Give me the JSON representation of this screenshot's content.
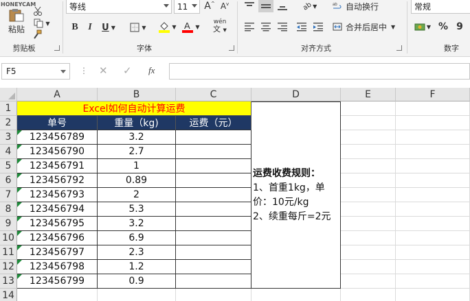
{
  "ribbon": {
    "clipboard": {
      "paste_label": "粘贴",
      "group_label": "剪贴板"
    },
    "font": {
      "name": "等线",
      "size": "11",
      "bold": "B",
      "italic": "I",
      "underline": "U",
      "phonetic": "wén",
      "group_label": "字体"
    },
    "alignment": {
      "wrap_label": "自动换行",
      "merge_label": "合并后居中",
      "group_label": "对齐方式"
    },
    "number": {
      "format": "常规",
      "percent": "%",
      "comma": "9",
      "group_label": "数字"
    }
  },
  "formula_bar": {
    "name_box": "F5",
    "fx": "fx",
    "content": ""
  },
  "watermark": "HONEYCAM",
  "columns": [
    "A",
    "B",
    "C",
    "D",
    "E",
    "F"
  ],
  "rows": [
    "1",
    "2",
    "3",
    "4",
    "5",
    "6",
    "7",
    "8",
    "9",
    "10",
    "11",
    "12",
    "13",
    "14"
  ],
  "sheet": {
    "title": "Excel如何自动计算运费",
    "headers": [
      "单号",
      "重量（kg)",
      "运费（元）"
    ],
    "records": [
      {
        "id": "123456789",
        "weight": "3.2"
      },
      {
        "id": "123456790",
        "weight": "2.7"
      },
      {
        "id": "123456791",
        "weight": "1"
      },
      {
        "id": "123456792",
        "weight": "0.89"
      },
      {
        "id": "123456793",
        "weight": "2"
      },
      {
        "id": "123456794",
        "weight": "5.3"
      },
      {
        "id": "123456795",
        "weight": "3.2"
      },
      {
        "id": "123456796",
        "weight": "6.9"
      },
      {
        "id": "123456797",
        "weight": "2.3"
      },
      {
        "id": "123456798",
        "weight": "1.2"
      },
      {
        "id": "123456799",
        "weight": "0.9"
      }
    ],
    "rules": {
      "heading": "运费收费规则：",
      "line1": "1、首重1kg，单",
      "line2": "价：10元/kg",
      "line3": "2、续重每斤=2元"
    }
  },
  "colors": {
    "title_bg": "#ffff00",
    "title_text": "#ff0000",
    "header_bg": "#1f3864",
    "header_text": "#ffffff",
    "error_marker": "#1e8b3a"
  }
}
